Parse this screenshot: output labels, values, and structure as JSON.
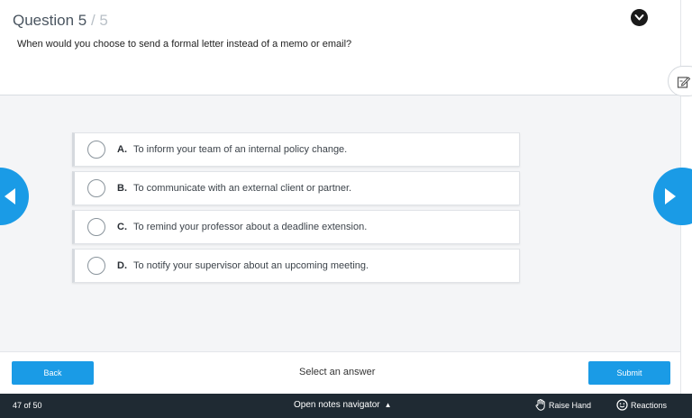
{
  "question": {
    "label": "Question 5",
    "separator": " / ",
    "total": "5",
    "text": "When would you choose to send a formal letter instead of a memo or email?"
  },
  "options": [
    {
      "letter": "A.",
      "text": "To inform your team of an internal policy change."
    },
    {
      "letter": "B.",
      "text": "To communicate with an external client or partner."
    },
    {
      "letter": "C.",
      "text": "To remind your professor about a deadline extension."
    },
    {
      "letter": "D.",
      "text": "To notify your supervisor about an upcoming meeting."
    }
  ],
  "footer": {
    "back_label": "Back",
    "status": "Select an answer",
    "submit_label": "Submit"
  },
  "bottombar": {
    "counter": "47 of 50",
    "notes_navigator": "Open notes navigator",
    "notes_arrow": "▲",
    "raise_hand": "Raise Hand",
    "reactions": "Reactions"
  },
  "colors": {
    "accent": "#1a9be6",
    "bottombar": "#1f2a33"
  },
  "icons": {
    "collapse": "chevron-down-icon",
    "notes": "edit-note-icon",
    "prev": "arrow-left-icon",
    "next": "arrow-right-icon",
    "raise_hand": "hand-icon",
    "reactions": "smiley-icon"
  }
}
